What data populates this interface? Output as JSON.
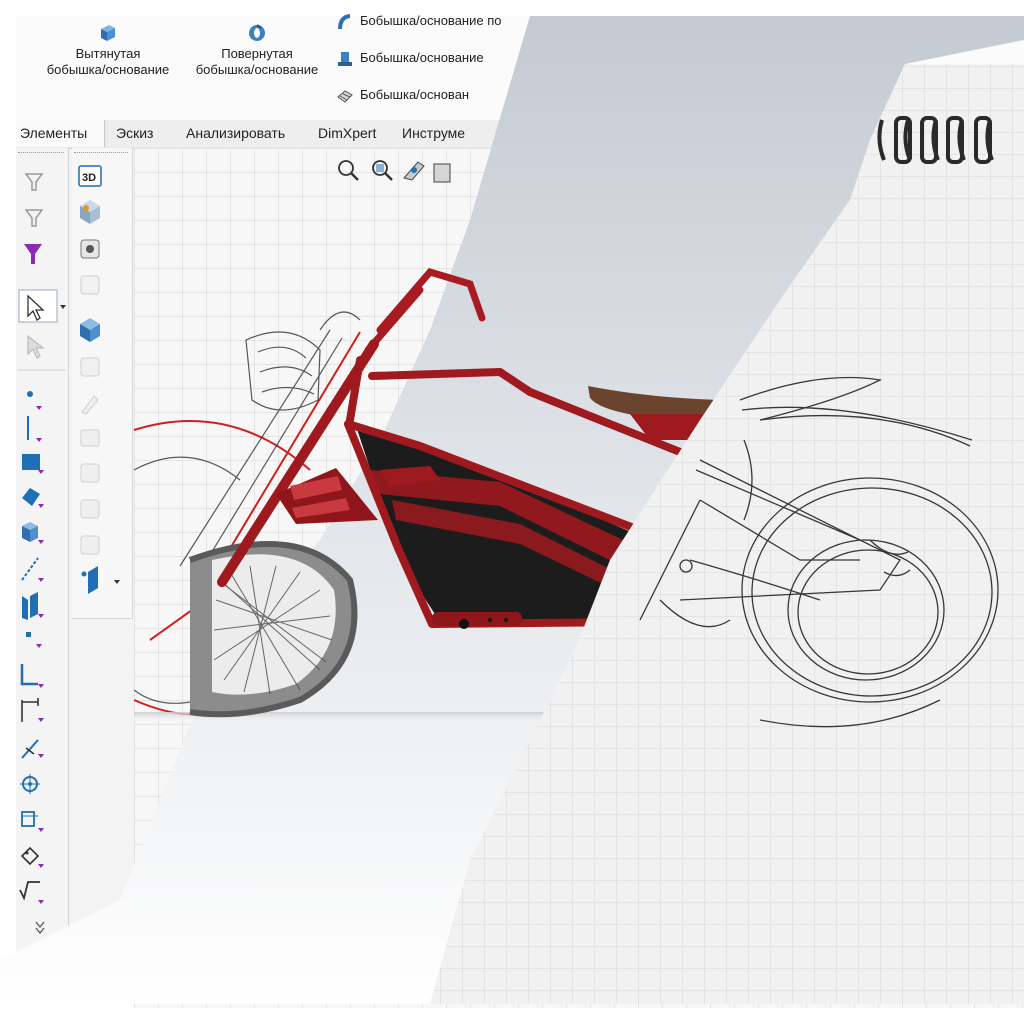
{
  "ribbon": {
    "extruded_label": "Вытянутая\nбобышка/основание",
    "revolved_label": "Повернутая\nбобышка/основание",
    "sweep_label": "Бобышка/основание по",
    "loft_label": "Бобышка/основание",
    "boundary_label": "Бобышка/основан"
  },
  "tabs": [
    {
      "label": "Элементы"
    },
    {
      "label": "Эскиз"
    },
    {
      "label": "Анализировать"
    },
    {
      "label": "DimXpert"
    },
    {
      "label": "Инструме"
    }
  ],
  "left_toolbar": {
    "icons": [
      "filter-icon",
      "filter-icon",
      "filter-icon",
      "select-arrow-icon",
      "select-arrow-icon",
      "point-icon",
      "line-icon",
      "face-icon",
      "surface-icon",
      "solid-icon",
      "edge-icon",
      "plane-icon",
      "vertex-icon",
      "corner-icon",
      "dimension-icon",
      "slope-icon",
      "target-icon",
      "layer-icon",
      "tag-icon",
      "sqrt-icon",
      "more-chevron-icon"
    ]
  },
  "second_toolbar": {
    "icons": [
      "3d-icon",
      "part-icon",
      "cube-icon",
      "cube-icon",
      "cube-icon",
      "cube-icon",
      "cube-icon",
      "cube-icon",
      "cube-icon",
      "cube-icon",
      "cube-icon",
      "cube-icon",
      "plane-dropdown-icon"
    ],
    "label_3d": "3D"
  },
  "view_tools": [
    "zoom-fit-icon",
    "zoom-area-icon",
    "previous-view-icon",
    "section-view-icon"
  ],
  "colors": {
    "frame_red": "#9e1a1f",
    "panel_black": "#1c1c1c",
    "seat_brown": "#6b4430",
    "accent_blue": "#1f6fb5"
  }
}
